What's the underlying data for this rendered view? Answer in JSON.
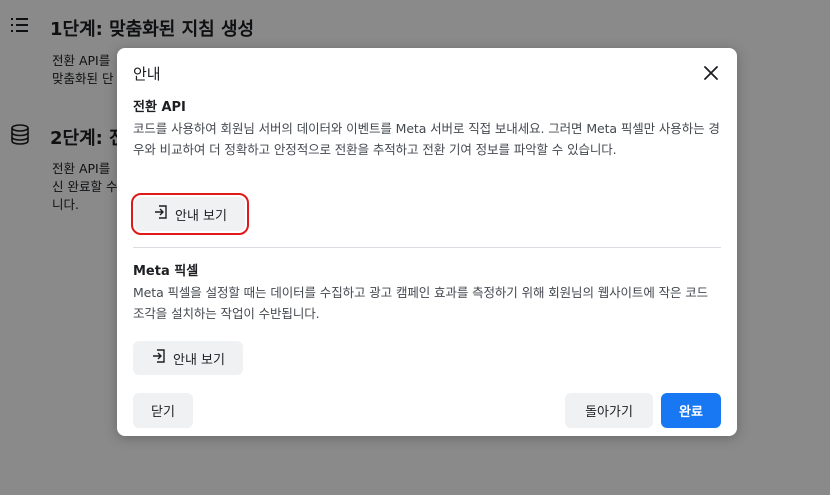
{
  "background": {
    "step1": {
      "title": "1단계: 맞춤화된 지침 생성",
      "desc_line1": "전환 API를",
      "desc_line2": "맞춤화된 단"
    },
    "step2": {
      "title": "2단계: 전",
      "desc_line1": "전환 API를",
      "desc_line2": "신 완료할 수",
      "desc_line3": "니다."
    }
  },
  "dialog": {
    "title": "안내",
    "conversion_api": {
      "title": "전환 API",
      "description": "코드를 사용하여 회원님 서버의 데이터와 이벤트를 Meta 서버로 직접 보내세요. 그러면 Meta 픽셀만 사용하는 경우와 비교하여 더 정확하고 안정적으로 전환을 추적하고 전환 기여 정보를 파악할 수 있습니다.",
      "button_label": "안내 보기"
    },
    "meta_pixel": {
      "title": "Meta 픽셀",
      "description": "Meta 픽셀을 설정할 때는 데이터를 수집하고 광고 캠페인 효과를 측정하기 위해 회원님의 웹사이트에 작은 코드 조각을 설치하는 작업이 수반됩니다.",
      "button_label": "안내 보기"
    },
    "footer": {
      "close_label": "닫기",
      "back_label": "돌아가기",
      "done_label": "완료"
    }
  },
  "colors": {
    "primary": "#1877f2",
    "highlight": "#e01919"
  },
  "icons": [
    "list-icon",
    "database-icon",
    "close-icon",
    "login-arrow-icon"
  ]
}
